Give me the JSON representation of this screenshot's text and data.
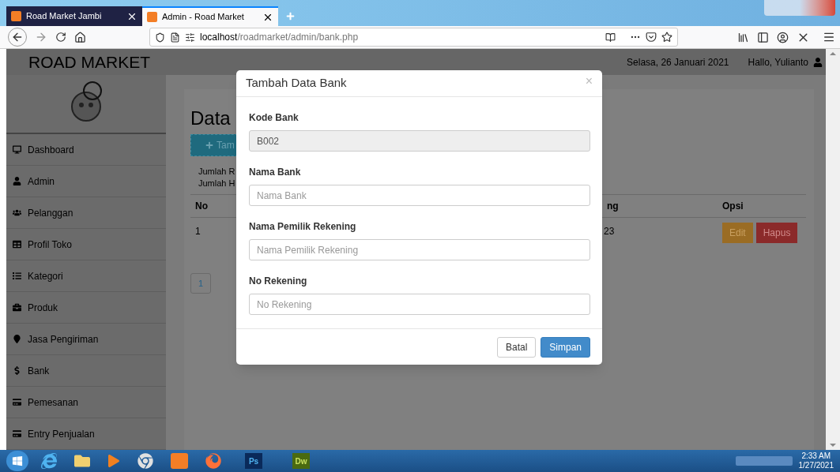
{
  "browser": {
    "tabs": [
      {
        "title": "Road Market Jambi",
        "selected": false
      },
      {
        "title": "Admin - Road Market",
        "selected": true
      }
    ],
    "url": {
      "host": "localhost",
      "path": "/roadmarket/admin/bank.php"
    }
  },
  "header": {
    "brand": "ROAD MARKET",
    "date": "Selasa, 26 Januari 2021",
    "greeting": "Hallo, Yulianto"
  },
  "sidebar": {
    "items": [
      {
        "label": "Dashboard"
      },
      {
        "label": "Admin"
      },
      {
        "label": "Pelanggan"
      },
      {
        "label": "Profil Toko"
      },
      {
        "label": "Kategori"
      },
      {
        "label": "Produk"
      },
      {
        "label": "Jasa Pengiriman"
      },
      {
        "label": "Bank"
      },
      {
        "label": "Pemesanan"
      },
      {
        "label": "Entry Penjualan"
      }
    ]
  },
  "content": {
    "title": "Data",
    "add_button": "Tam",
    "summary": [
      "Jumlah R",
      "Jumlah H"
    ],
    "table": {
      "columns": [
        "No",
        "ng",
        "Opsi"
      ],
      "rows": [
        {
          "no": "1",
          "column_2": "23",
          "actions": [
            "Edit",
            "Hapus"
          ]
        }
      ]
    },
    "pagination": [
      {
        "label": "1",
        "selected": true
      }
    ]
  },
  "modal": {
    "title": "Tambah Data Bank",
    "close": "×",
    "fields": [
      {
        "label": "Kode Bank",
        "value": "B002",
        "disabled": true
      },
      {
        "label": "Nama Bank",
        "placeholder": "Nama Bank",
        "disabled": false
      },
      {
        "label": "Nama Pemilik Rekening",
        "placeholder": "Nama Pemilik Rekening",
        "disabled": false
      },
      {
        "label": "No Rekening",
        "placeholder": "No Rekening",
        "disabled": false
      }
    ],
    "buttons": [
      {
        "label": "Batal",
        "kind": "default"
      },
      {
        "label": "Simpan",
        "kind": "primary"
      }
    ]
  },
  "taskbar": {
    "apps": [
      {
        "label": "Ps"
      },
      {
        "label": "Dw"
      }
    ],
    "time": "2:33 AM",
    "date": "1/27/2021"
  }
}
